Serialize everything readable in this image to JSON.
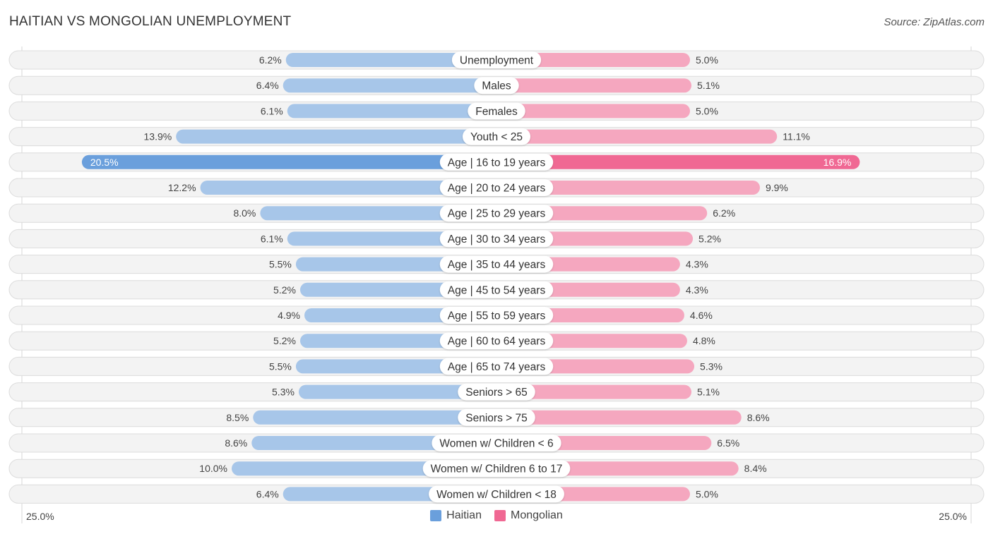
{
  "header": {
    "title": "HAITIAN VS MONGOLIAN UNEMPLOYMENT",
    "source": "Source: ZipAtlas.com"
  },
  "axis": {
    "left_label": "25.0%",
    "right_label": "25.0%"
  },
  "legend": {
    "items": [
      {
        "label": "Haitian",
        "color": "#6a9fdc"
      },
      {
        "label": "Mongolian",
        "color": "#f06893"
      }
    ]
  },
  "colors": {
    "haitian_light": "#a7c6e9",
    "haitian_dark": "#6a9fdc",
    "mongolian_light": "#f5a7bf",
    "mongolian_dark": "#f06893",
    "row_bg": "#f3f3f3",
    "row_border": "#dcdcdc"
  },
  "chart_data": {
    "type": "bar",
    "orientation": "horizontal-diverging",
    "title": "HAITIAN VS MONGOLIAN UNEMPLOYMENT",
    "xlabel": "",
    "ylabel": "",
    "xlim": [
      0,
      25.0
    ],
    "value_format": "percent-1dp",
    "legend_position": "bottom-center",
    "categories": [
      "Unemployment",
      "Males",
      "Females",
      "Youth < 25",
      "Age | 16 to 19 years",
      "Age | 20 to 24 years",
      "Age | 25 to 29 years",
      "Age | 30 to 34 years",
      "Age | 35 to 44 years",
      "Age | 45 to 54 years",
      "Age | 55 to 59 years",
      "Age | 60 to 64 years",
      "Age | 65 to 74 years",
      "Seniors > 65",
      "Seniors > 75",
      "Women w/ Children < 6",
      "Women w/ Children 6 to 17",
      "Women w/ Children < 18"
    ],
    "series": [
      {
        "name": "Haitian",
        "side": "left",
        "values": [
          6.2,
          6.4,
          6.1,
          13.9,
          20.5,
          12.2,
          8.0,
          6.1,
          5.5,
          5.2,
          4.9,
          5.2,
          5.5,
          5.3,
          8.5,
          8.6,
          10.0,
          6.4
        ]
      },
      {
        "name": "Mongolian",
        "side": "right",
        "values": [
          5.0,
          5.1,
          5.0,
          11.1,
          16.9,
          9.9,
          6.2,
          5.2,
          4.3,
          4.3,
          4.6,
          4.8,
          5.3,
          5.1,
          8.6,
          6.5,
          8.4,
          5.0
        ]
      }
    ],
    "highlighted_category": "Age | 16 to 19 years"
  }
}
